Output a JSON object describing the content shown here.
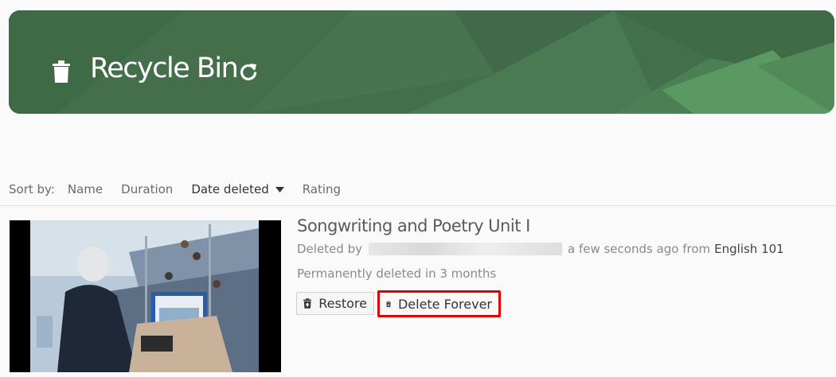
{
  "header": {
    "title": "Recycle Bin",
    "icons": {
      "left": "trash-icon",
      "right": "refresh-icon"
    },
    "colors": {
      "banner": "#426f49",
      "banner_light": "#5a9a62"
    }
  },
  "sort": {
    "label": "Sort by:",
    "options": [
      {
        "label": "Name",
        "active": false
      },
      {
        "label": "Duration",
        "active": false
      },
      {
        "label": "Date deleted",
        "active": true
      },
      {
        "label": "Rating",
        "active": false
      }
    ],
    "active_indicator_icon": "caret-down-icon"
  },
  "items": [
    {
      "title": "Songwriting and Poetry Unit I",
      "deleted_by_prefix": "Deleted by",
      "deleted_when": "a few seconds ago from",
      "course": "English 101",
      "permanent_notice": "Permanently deleted in 3 months",
      "restore_label": "Restore",
      "delete_label": "Delete Forever",
      "highlight_color": "#e00000"
    }
  ]
}
